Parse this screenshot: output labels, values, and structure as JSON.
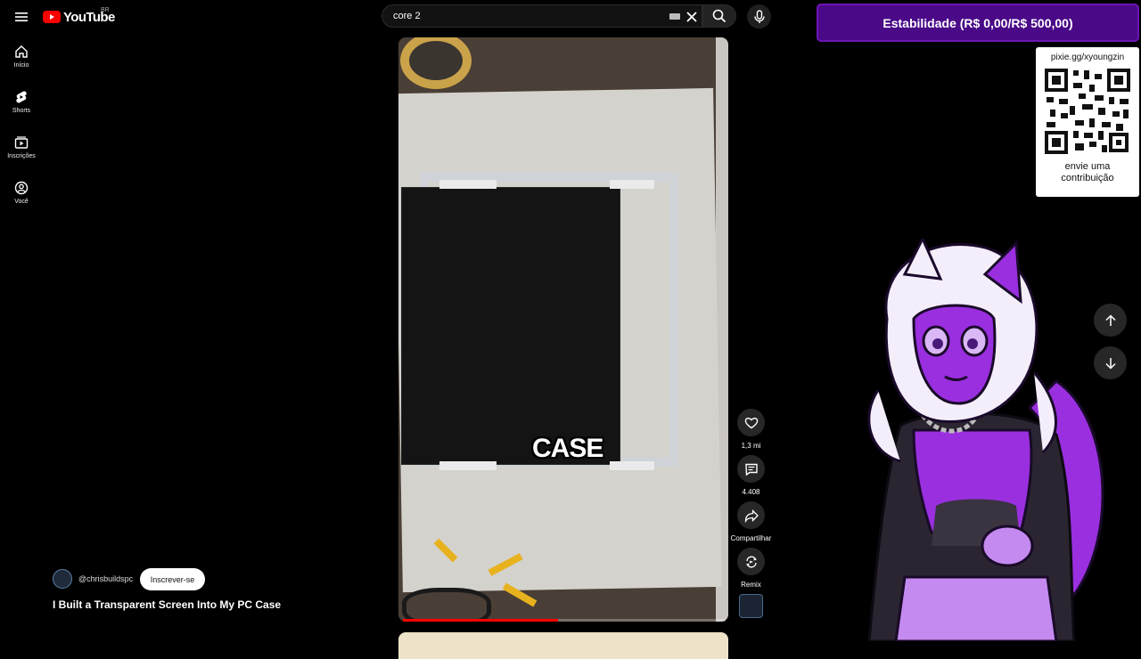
{
  "header": {
    "logo_text": "YouTube",
    "region": "BR",
    "search": {
      "value": "core 2"
    }
  },
  "sidebar": {
    "items": [
      {
        "label": "Início",
        "icon": "home-icon"
      },
      {
        "label": "Shorts",
        "icon": "shorts-icon"
      },
      {
        "label": "Inscrições",
        "icon": "subscriptions-icon"
      },
      {
        "label": "Você",
        "icon": "user-circle-icon"
      }
    ]
  },
  "short": {
    "caption": "CASE",
    "channel": "@chrisbuildspc",
    "subscribe_label": "Inscrever-se",
    "title": "I Built a Transparent Screen Into My PC Case",
    "progress": 0.48
  },
  "actions": {
    "likes": "1,3 mi",
    "comments": "4.408",
    "share_label": "Compartilhar",
    "remix_label": "Remix"
  },
  "overlay": {
    "goal": "Estabilidade (R$ 0,00/R$ 500,00)",
    "donation_url": "pixie.gg/xyoungzin",
    "donation_cta_line1": "envie uma",
    "donation_cta_line2": "contribuição"
  },
  "colors": {
    "accent": "#ff0000",
    "goal_bg": "#4a0a87",
    "mascot_purple": "#9a2fe0"
  }
}
